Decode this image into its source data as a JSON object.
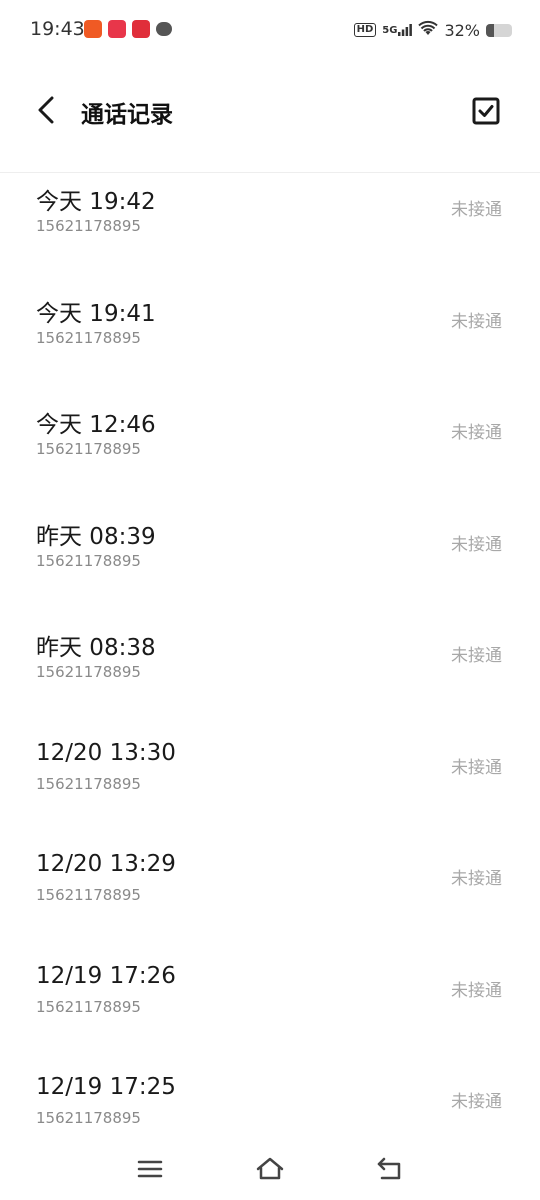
{
  "status_bar": {
    "time": "19:43",
    "network": "5G",
    "hd": "HD",
    "battery_text": "32%",
    "battery_level": 0.32
  },
  "header": {
    "title": "通话记录"
  },
  "calls": [
    {
      "datetime": "今天 19:42",
      "number": "15621178895",
      "status": "未接通"
    },
    {
      "datetime": "今天 19:41",
      "number": "15621178895",
      "status": "未接通"
    },
    {
      "datetime": "今天 12:46",
      "number": "15621178895",
      "status": "未接通"
    },
    {
      "datetime": "昨天 08:39",
      "number": "15621178895",
      "status": "未接通"
    },
    {
      "datetime": "昨天 08:38",
      "number": "15621178895",
      "status": "未接通"
    },
    {
      "datetime": "12/20 13:30",
      "number": "15621178895",
      "status": "未接通"
    },
    {
      "datetime": "12/20 13:29",
      "number": "15621178895",
      "status": "未接通"
    },
    {
      "datetime": "12/19 17:26",
      "number": "15621178895",
      "status": "未接通"
    },
    {
      "datetime": "12/19 17:25",
      "number": "15621178895",
      "status": "未接通"
    }
  ],
  "colors": {
    "primary_text": "#1a1a1a",
    "secondary_text": "#8a8a8a",
    "status_text": "#a8a8a8"
  }
}
